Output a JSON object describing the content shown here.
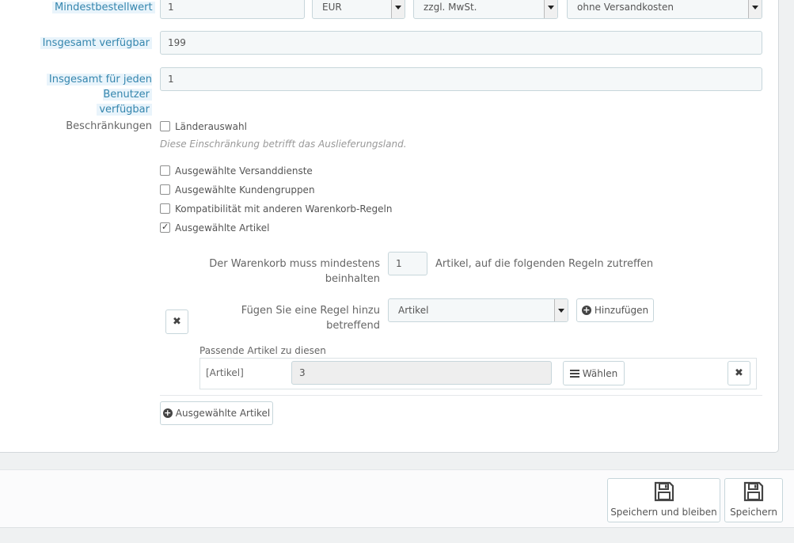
{
  "min_order": {
    "label": "Mindestbestellwert",
    "amount": "1",
    "currency": "EUR",
    "tax": "zzgl. MwSt.",
    "shipping": "ohne Versandkosten"
  },
  "total_available": {
    "label": "Insgesamt verfügbar",
    "value": "199"
  },
  "per_user": {
    "label_line1": "Insgesamt für jeden Benutzer",
    "label_line2": "verfügbar",
    "value": "1"
  },
  "restrictions": {
    "label": "Beschränkungen",
    "country": {
      "label": "Länderauswahl",
      "checked": false
    },
    "hint": "Diese Einschränkung betrifft das Auslieferungsland.",
    "carriers": {
      "label": "Ausgewählte Versanddienste",
      "checked": false
    },
    "groups": {
      "label": "Ausgewählte Kundengruppen",
      "checked": false
    },
    "compat": {
      "label": "Kompatibilität mit anderen Warenkorb-Regeln",
      "checked": false
    },
    "products": {
      "label": "Ausgewählte Artikel",
      "checked": true
    }
  },
  "product_rule": {
    "cart_must_line1": "Der Warenkorb muss mindestens",
    "cart_must_line2": "beinhalten",
    "quantity": "1",
    "suffix": "Artikel, auf die folgenden Regeln zutreffen",
    "add_rule_line1": "Fügen Sie eine Regel hinzu",
    "add_rule_line2": "betreffend",
    "rule_type": "Artikel",
    "add_button": "Hinzufügen",
    "matching_label": "Passende Artikel zu diesen",
    "item_type": "[Artikel]",
    "item_count": "3",
    "choose_button": "Wählen",
    "add_group_button": "Ausgewählte Artikel"
  },
  "footer": {
    "save_stay": "Speichern und bleiben",
    "save": "Speichern"
  }
}
